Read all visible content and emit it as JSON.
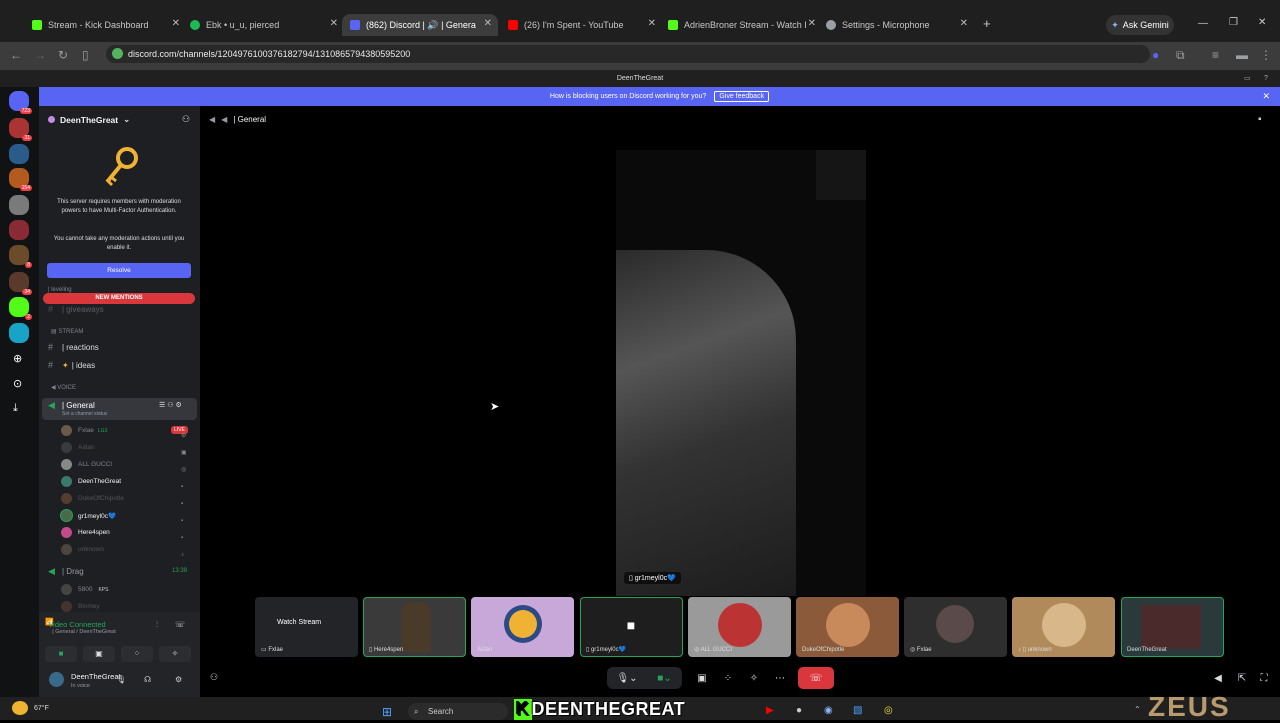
{
  "browser": {
    "tabs": [
      {
        "label": "Stream - Kick Dashboard",
        "color": "#53fc18"
      },
      {
        "label": "Ebk • u_u, pierced",
        "color": "#1db954"
      },
      {
        "label": "(862) Discord | 🔊 | Genera",
        "color": "#5865f2"
      },
      {
        "label": "(26) I'm Spent - YouTube",
        "color": "#ff0000"
      },
      {
        "label": "AdrienBroner Stream - Watch I",
        "color": "#53fc18"
      },
      {
        "label": "Settings - Microphone",
        "color": "#9aa0a6"
      }
    ],
    "new_tab": "+",
    "gemini": "Ask Gemini",
    "url": "discord.com/channels/1204976100376182794/1310865794380595200"
  },
  "site_title": "DeenTheGreat",
  "banner": {
    "text": "How is blocking users on Discord working for you?",
    "button": "Give feedback"
  },
  "guild_badges": [
    "723",
    "31",
    "154",
    "8",
    "34",
    "2"
  ],
  "server": {
    "name": "DeenTheGreat",
    "mfa_text": "This server requires members with moderation powers to have Multi-Factor Authentication.",
    "mfa_sub": "You cannot take any moderation actions until you enable it.",
    "resolve": "Resolve",
    "new_mentions": "NEW MENTIONS",
    "channels": {
      "leveling": "| leveling",
      "giveaways": "| giveaways",
      "stream_cat": "STREAM",
      "reactions": "| reactions",
      "ideas": "| ideas",
      "voice_cat": "VOICE",
      "general": "| General",
      "general_status": "Set a channel status",
      "drag": "| Drag",
      "drag_time": "13:39"
    },
    "voice_users": [
      "Fxlae",
      "Aidan",
      "ALL GUCCI",
      "DeenTheGreat",
      "DukeOfChipotle",
      "gr1meyl0c💙",
      "Here4spen",
      "unknown"
    ],
    "fxlae_tag": "LG3",
    "live": "LIVE",
    "drag_users": [
      "5800",
      "Binmey"
    ],
    "drag_tag": "KPS"
  },
  "voice_status": {
    "title": "Video Connected",
    "sub": "| General / DeenTheGreat"
  },
  "user": {
    "name": "DeenTheGreat",
    "status": "In voice"
  },
  "main": {
    "channel": "| General",
    "focus_name": "gr1meyl0c💙",
    "tiles": [
      "Fxlae",
      "Here4spen",
      "Aidan",
      "gr1meyl0c💙",
      "ALL GUCCI",
      "DukeOfChipotle",
      "Fxlae",
      "unknown",
      "DeenTheGreat"
    ],
    "watch_stream": "Watch Stream"
  },
  "os": {
    "temp": "67°F",
    "search": "Search",
    "overlay": "DEENTHEGREAT",
    "watermark": "ZEUS"
  }
}
